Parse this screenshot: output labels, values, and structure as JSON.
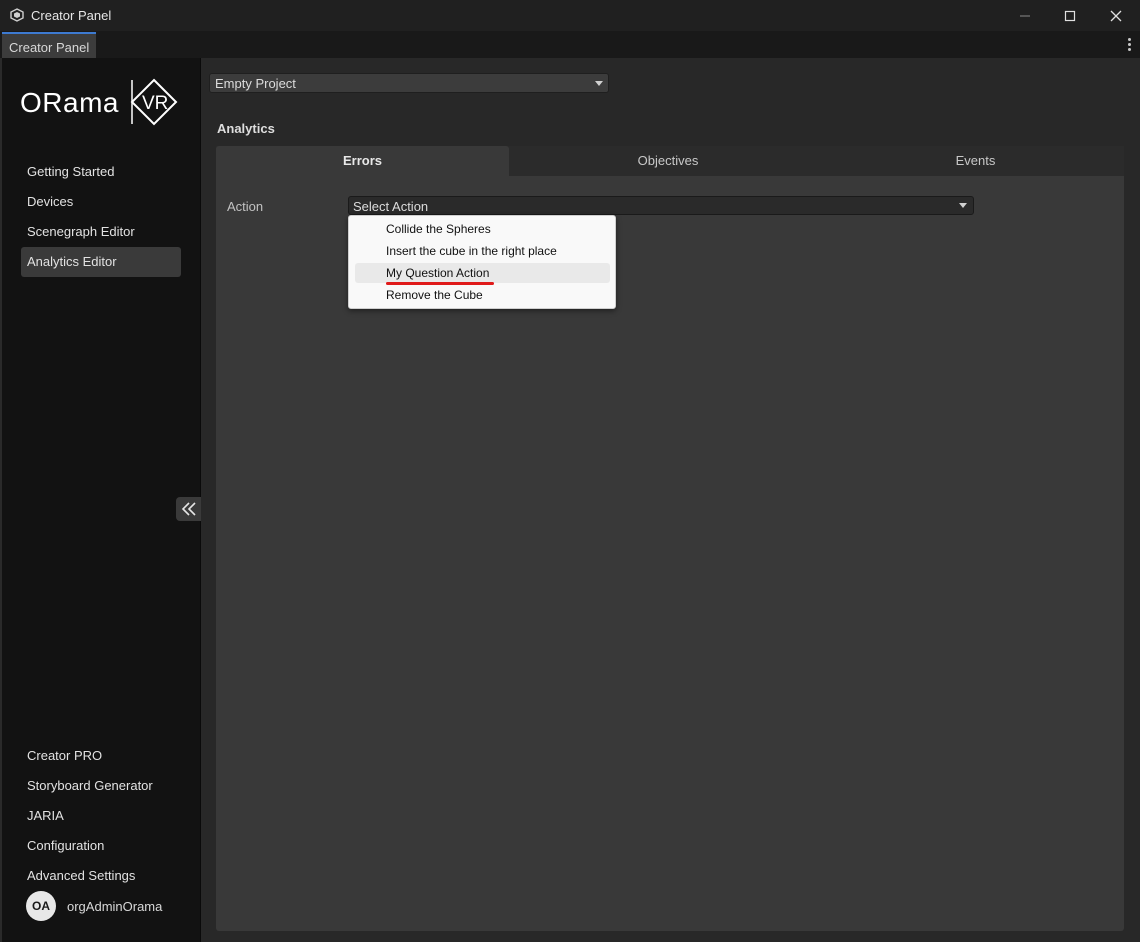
{
  "window": {
    "title": "Creator Panel",
    "tab_label": "Creator Panel"
  },
  "brand": {
    "logo_text": "ORama",
    "logo_badge": "VR"
  },
  "sidebar": {
    "top_items": [
      {
        "label": "Getting Started"
      },
      {
        "label": "Devices"
      },
      {
        "label": "Scenegraph Editor"
      },
      {
        "label": "Analytics Editor",
        "active": true
      }
    ],
    "bottom_items": [
      {
        "label": "Creator PRO"
      },
      {
        "label": "Storyboard Generator"
      },
      {
        "label": "JARIA"
      },
      {
        "label": "Configuration"
      },
      {
        "label": "Advanced Settings"
      }
    ],
    "user": {
      "initials": "OA",
      "name": "orgAdminOrama"
    }
  },
  "main": {
    "project_select": {
      "value": "Empty Project"
    },
    "section_title": "Analytics",
    "tabs": [
      {
        "label": "Errors",
        "active": true
      },
      {
        "label": "Objectives"
      },
      {
        "label": "Events"
      }
    ],
    "action": {
      "label": "Action",
      "placeholder": "Select Action",
      "options": [
        {
          "label": "Collide the Spheres"
        },
        {
          "label": "Insert the cube in the right place"
        },
        {
          "label": "My Question Action",
          "hovered": true
        },
        {
          "label": "Remove the Cube"
        }
      ]
    }
  },
  "colors": {
    "accent_tab": "#3d7ad1",
    "underline": "#e01a1a"
  }
}
